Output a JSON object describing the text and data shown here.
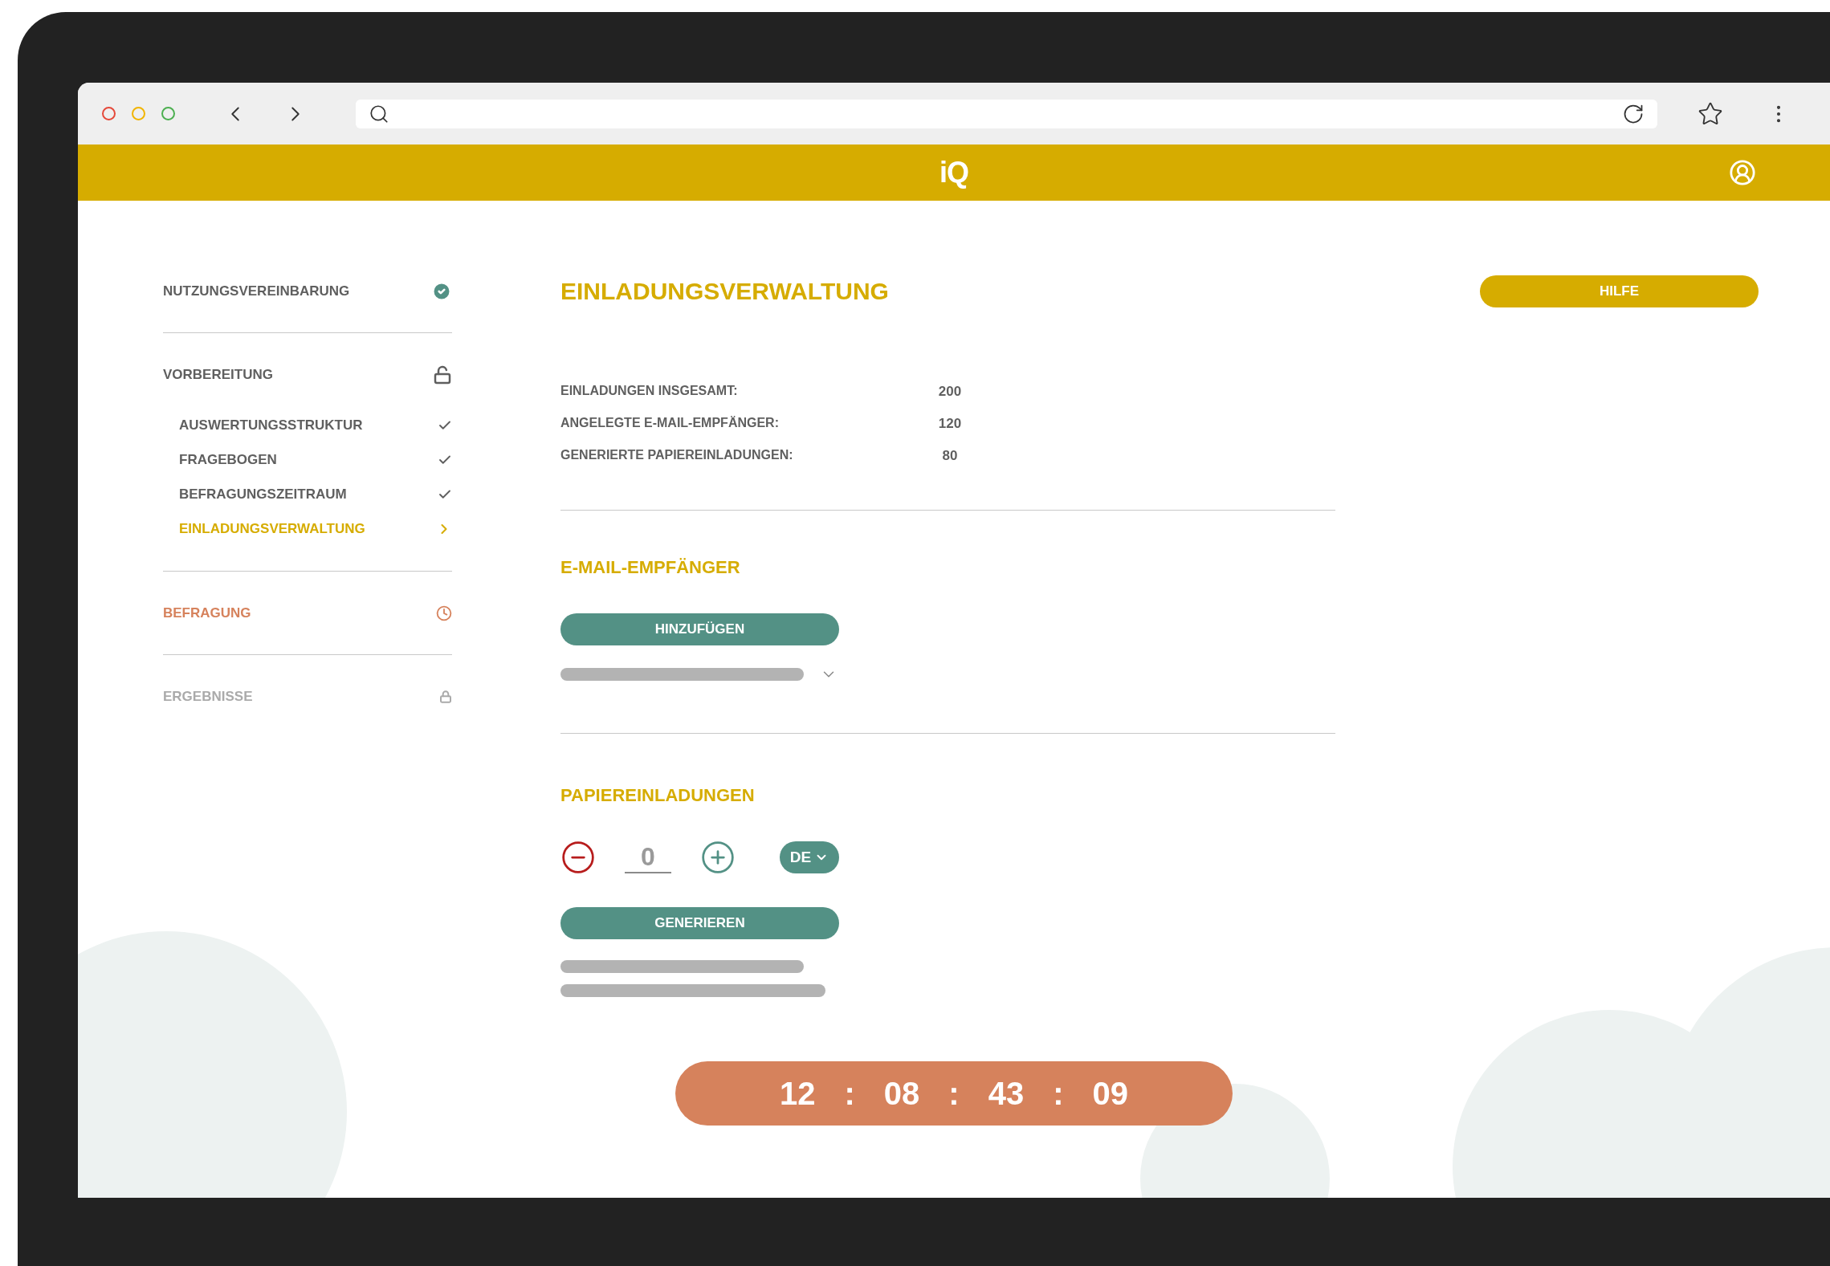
{
  "header": {
    "logo": "iQ"
  },
  "sidebar": {
    "sections": [
      {
        "label": "NUTZUNGSVEREINBARUNG",
        "kind": "done"
      },
      {
        "label": "VORBEREITUNG",
        "kind": "open",
        "children": [
          {
            "label": "AUSWERTUNGSSTRUKTUR",
            "selected": false
          },
          {
            "label": "FRAGEBOGEN",
            "selected": false
          },
          {
            "label": "BEFRAGUNGSZEITRAUM",
            "selected": false
          },
          {
            "label": "EINLADUNGSVERWALTUNG",
            "selected": true
          }
        ]
      },
      {
        "label": "BEFRAGUNG",
        "kind": "running"
      },
      {
        "label": "ERGEBNISSE",
        "kind": "locked"
      }
    ]
  },
  "main": {
    "title": "EINLADUNGSVERWALTUNG",
    "help_button": "HILFE",
    "stats": [
      {
        "label": "EINLADUNGEN INSGESAMT:",
        "value": "200"
      },
      {
        "label": "ANGELEGTE E-MAIL-EMPFÄNGER:",
        "value": "120"
      },
      {
        "label": "GENERIERTE PAPIEREINLADUNGEN:",
        "value": "80"
      }
    ],
    "email_section": {
      "title": "E-MAIL-EMPFÄNGER",
      "button": "HINZUFÜGEN"
    },
    "paper_section": {
      "title": "PAPIEREINLADUNGEN",
      "count": "0",
      "language": "DE",
      "button": "GENERIEREN"
    }
  },
  "timer": {
    "parts": [
      "12",
      ":",
      "08",
      ":",
      "43",
      ":",
      "09"
    ]
  }
}
